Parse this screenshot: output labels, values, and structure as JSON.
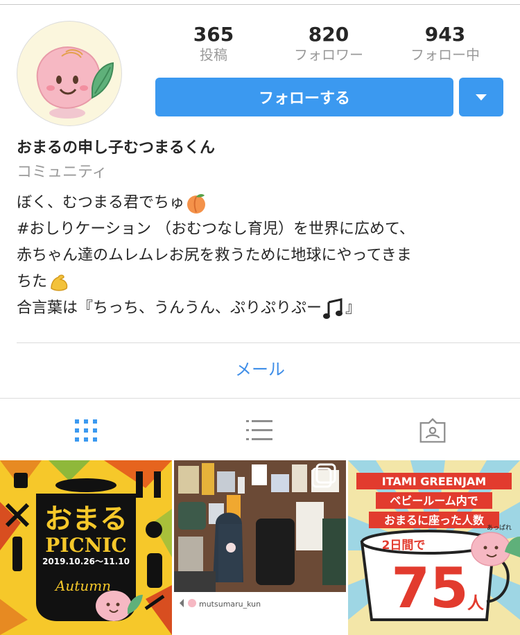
{
  "profile": {
    "name": "おまるの申し子むつまるくん",
    "category": "コミュニティ",
    "bio_lines": [
      "ぼく、むつまる君でちゅ",
      "#おしりケーション （おむつなし育児）を世界に広めて、",
      "赤ちゃん達のムレムレお尻を救うために地球にやってきま",
      "ちた",
      "合言葉は『ちっち、うんうん、ぷりぷりぷー",
      "』"
    ]
  },
  "stats": [
    {
      "value": "365",
      "label": "投稿"
    },
    {
      "value": "820",
      "label": "フォロワー"
    },
    {
      "value": "943",
      "label": "フォロー中"
    }
  ],
  "actions": {
    "follow_label": "フォローする",
    "mail_label": "メール"
  },
  "tabs": [
    {
      "icon": "grid-icon",
      "active": true
    },
    {
      "icon": "list-icon",
      "active": false
    },
    {
      "icon": "tagged-icon",
      "active": false
    }
  ],
  "posts": {
    "picnic": {
      "title": "おまる",
      "subtitle": "PICNIC",
      "dates": "2019.10.26〜11.10",
      "season": "Autumn"
    },
    "flatlay": {
      "repost_user": "mutsumaru_kun"
    },
    "greenjam": {
      "line1": "ITAMI GREENJAM",
      "line2": "ベビールーム内で",
      "line3": "おまるに座った人数",
      "period": "2日間で",
      "count": "75",
      "unit": "人",
      "exclaim": "あっぱれ"
    }
  },
  "colors": {
    "accent": "#3b99f0",
    "link": "#3f8ee8",
    "muted": "#9a9a9a"
  }
}
